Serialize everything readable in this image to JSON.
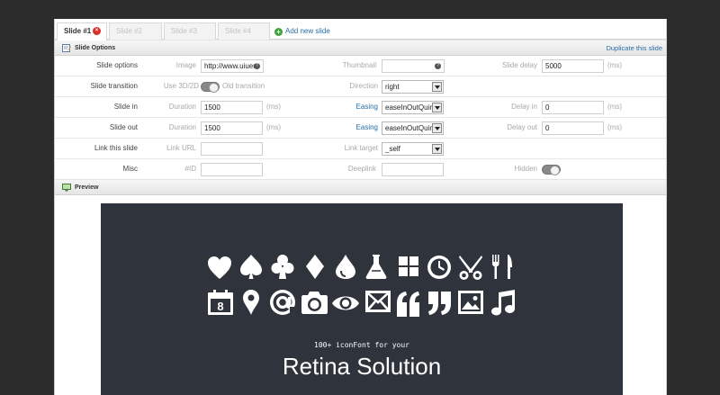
{
  "tabs": [
    {
      "label": "Slide #1",
      "active": true
    },
    {
      "label": "Slide #2",
      "active": false
    },
    {
      "label": "Slide #3",
      "active": false
    },
    {
      "label": "Slide #4",
      "active": false
    }
  ],
  "add_slide_label": "Add new slide",
  "slide_options": {
    "title": "Slide Options",
    "duplicate_label": "Duplicate this slide",
    "rows": {
      "options": {
        "label": "Slide options",
        "image_label": "Image",
        "image_value": "http://www.uiueu",
        "thumbnail_label": "Thumbnail",
        "thumbnail_value": "",
        "delay_label": "Slide delay",
        "delay_value": "5000",
        "delay_unit": "(ms)"
      },
      "transition": {
        "label": "Slide transition",
        "use3d_label": "Use 3D/2D",
        "old_label": "Old transition",
        "direction_label": "Direction",
        "direction_value": "right"
      },
      "slide_in": {
        "label": "Slide in",
        "duration_label": "Duration",
        "duration_value": "1500",
        "duration_unit": "(ms)",
        "easing_label": "Easing",
        "easing_value": "easeInOutQuint",
        "delay_label": "Delay in",
        "delay_value": "0",
        "delay_unit": "(ms)"
      },
      "slide_out": {
        "label": "Slide out",
        "duration_label": "Duration",
        "duration_value": "1500",
        "duration_unit": "(ms)",
        "easing_label": "Easing",
        "easing_value": "easeInOutQuint",
        "delay_label": "Delay out",
        "delay_value": "0",
        "delay_unit": "(ms)"
      },
      "link": {
        "label": "Link this slide",
        "url_label": "Link URL",
        "url_value": "",
        "target_label": "Link target",
        "target_value": "_self"
      },
      "misc": {
        "label": "Misc",
        "id_label": "#ID",
        "id_value": "",
        "deeplink_label": "Deeplink",
        "deeplink_value": "",
        "hidden_label": "Hidden"
      }
    }
  },
  "preview": {
    "title": "Preview",
    "caption": "100+ iconFont for your",
    "headline": "Retina Solution",
    "calendar_day": "8",
    "icons_row1": [
      "heart-icon",
      "spade-icon",
      "club-icon",
      "diamond-icon",
      "drop-icon",
      "flask-icon",
      "grid-icon",
      "clock-icon",
      "scissors-icon",
      "cutlery-icon"
    ],
    "icons_row2": [
      "calendar-icon",
      "map-pin-icon",
      "at-icon",
      "camera-icon",
      "eye-icon",
      "envelope-icon",
      "quote-open-icon",
      "quote-close-icon",
      "image-icon",
      "music-icon"
    ]
  },
  "colors": {
    "background": "#2c2c2c",
    "accent": "#2a6ea6",
    "stage": "#2f343c",
    "close": "#d9302a",
    "add": "#3ea33a"
  }
}
